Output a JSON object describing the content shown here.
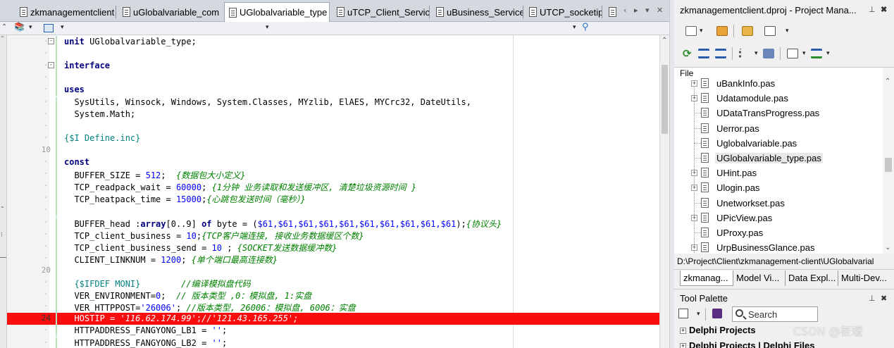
{
  "editor_tabs": [
    {
      "label": "zkmanagementclient"
    },
    {
      "label": "uGlobalvariable_com"
    },
    {
      "label": "UGlobalvariable_type"
    },
    {
      "label": "uTCP_Client_Service"
    },
    {
      "label": "uBusiness_Service"
    },
    {
      "label": "UTCP_socketip"
    }
  ],
  "active_tab": "UGlobalvariable_type",
  "code_lines": [
    {
      "num": "",
      "parts": [
        [
          "kw",
          "unit"
        ],
        [
          "plain",
          " UGlobalvariable_type;"
        ]
      ],
      "fold": "-"
    },
    {
      "num": "",
      "parts": []
    },
    {
      "num": "",
      "parts": [
        [
          "kw",
          "interface"
        ]
      ],
      "fold": "-"
    },
    {
      "num": "",
      "parts": []
    },
    {
      "num": "",
      "parts": [
        [
          "kw",
          "uses"
        ]
      ]
    },
    {
      "num": "",
      "parts": [
        [
          "plain",
          "  SysUtils, Winsock, Windows, System.Classes, MYzlib, ElAES, MYCrc32, DateUtils,"
        ]
      ]
    },
    {
      "num": "",
      "parts": [
        [
          "plain",
          "  System.Math;"
        ]
      ]
    },
    {
      "num": "",
      "parts": []
    },
    {
      "num": "",
      "parts": [
        [
          "dir",
          "{$I Define.inc}"
        ]
      ]
    },
    {
      "num": "10",
      "parts": []
    },
    {
      "num": "",
      "parts": [
        [
          "kw",
          "const"
        ]
      ]
    },
    {
      "num": "",
      "parts": [
        [
          "plain",
          "  BUFFER_SIZE = "
        ],
        [
          "num",
          "512"
        ],
        [
          "plain",
          ";  "
        ],
        [
          "cmt",
          "{数据包大小定义}"
        ]
      ]
    },
    {
      "num": "",
      "parts": [
        [
          "plain",
          "  TCP_readpack_wait = "
        ],
        [
          "num",
          "60000"
        ],
        [
          "plain",
          "; "
        ],
        [
          "cmt",
          "{1分钟 业务读取和发送缓冲区, 清楚垃圾资源时间 }"
        ]
      ]
    },
    {
      "num": "",
      "parts": [
        [
          "plain",
          "  TCP_heatpack_time = "
        ],
        [
          "num",
          "15000"
        ],
        [
          "plain",
          ";"
        ],
        [
          "cmt",
          "{心跳包发送时间（毫秒）}"
        ]
      ]
    },
    {
      "num": "",
      "parts": []
    },
    {
      "num": "",
      "parts": [
        [
          "plain",
          "  BUFFER_head :"
        ],
        [
          "kw",
          "array"
        ],
        [
          "plain",
          "[0..9] "
        ],
        [
          "kw",
          "of"
        ],
        [
          "plain",
          " byte = ("
        ],
        [
          "num",
          "$61,$61,$61,$61,$61,$61,$61,$61,$61,$61"
        ],
        [
          "plain",
          ");"
        ],
        [
          "cmt",
          "{协议头}"
        ]
      ]
    },
    {
      "num": "",
      "parts": [
        [
          "plain",
          "  TCP_client_business = "
        ],
        [
          "num",
          "10"
        ],
        [
          "plain",
          ";"
        ],
        [
          "cmt",
          "{TCP客户端连接, 接收业务数据缓区个数}"
        ]
      ]
    },
    {
      "num": "",
      "parts": [
        [
          "plain",
          "  TCP_client_business_send = "
        ],
        [
          "num",
          "10"
        ],
        [
          "plain",
          " ; "
        ],
        [
          "cmt",
          "{SOCKET发送数据缓冲数}"
        ]
      ]
    },
    {
      "num": "",
      "parts": [
        [
          "plain",
          "  CLIENT_LINKNUM = "
        ],
        [
          "num",
          "1200"
        ],
        [
          "plain",
          "; "
        ],
        [
          "cmt",
          "{单个端口最高连接数}"
        ]
      ]
    },
    {
      "num": "20",
      "parts": []
    },
    {
      "num": "",
      "parts": [
        [
          "dir",
          "  {$IFDEF MONI}"
        ],
        [
          "plain",
          "        "
        ],
        [
          "cmt",
          "//编译模拟盘代码"
        ]
      ]
    },
    {
      "num": "",
      "parts": [
        [
          "plain",
          "  VER_ENVIRONMENT="
        ],
        [
          "num",
          "0"
        ],
        [
          "plain",
          ";  "
        ],
        [
          "cmt",
          "// 版本类型 ,0：模拟盘, 1:实盘"
        ]
      ]
    },
    {
      "num": "",
      "parts": [
        [
          "plain",
          "  VER_HTTPPOST="
        ],
        [
          "str",
          "'26006'"
        ],
        [
          "plain",
          "; "
        ],
        [
          "cmt",
          "//版本类型, 26006：模拟盘, 6006：实盘"
        ]
      ]
    },
    {
      "num": "24",
      "parts": [
        [
          "plain",
          "  HOSTIP = "
        ],
        [
          "str",
          "'116.62.174.99'"
        ],
        [
          "plain",
          ";"
        ],
        [
          "cmt",
          "//'121.43.165.255';"
        ]
      ],
      "highlight": true
    },
    {
      "num": "",
      "parts": [
        [
          "plain",
          "  HTTPADDRESS_FANGYONG_LB1 = "
        ],
        [
          "str",
          "''"
        ],
        [
          "plain",
          ";"
        ]
      ]
    },
    {
      "num": "",
      "parts": [
        [
          "plain",
          "  HTTPADDRESS_FANGYONG_LB2 = "
        ],
        [
          "str",
          "''"
        ],
        [
          "plain",
          ";"
        ]
      ]
    }
  ],
  "project_manager": {
    "title": "zkmanagementclient.dproj - Project Mana...",
    "tree_header": "File",
    "files": [
      {
        "name": "uBankInfo.pas",
        "expandable": true
      },
      {
        "name": "Udatamodule.pas",
        "expandable": true
      },
      {
        "name": "UDataTransProgress.pas",
        "expandable": false
      },
      {
        "name": "Uerror.pas",
        "expandable": false
      },
      {
        "name": "Uglobalvariable.pas",
        "expandable": false
      },
      {
        "name": "UGlobalvariable_type.pas",
        "expandable": false,
        "selected": true
      },
      {
        "name": "UHint.pas",
        "expandable": true
      },
      {
        "name": "Ulogin.pas",
        "expandable": true
      },
      {
        "name": "Unetworkset.pas",
        "expandable": false
      },
      {
        "name": "UPicView.pas",
        "expandable": true
      },
      {
        "name": "UProxy.pas",
        "expandable": false
      },
      {
        "name": "UrpBusinessGlance.pas",
        "expandable": true
      }
    ],
    "path": "D:\\Project\\Client\\zkmanagement-client\\UGlobalvarial",
    "bottom_tabs": [
      "zkmanag...",
      "Model Vi...",
      "Data Expl...",
      "Multi-Dev..."
    ]
  },
  "tool_palette": {
    "title": "Tool Palette",
    "search_placeholder": "Search",
    "items": [
      "Delphi Projects",
      "Delphi Projects | Delphi Files"
    ]
  },
  "watermark": "CSDN @筱瑷",
  "colors": {
    "keyword": "#000080",
    "comment": "#008000",
    "string": "#0000ff",
    "highlight_line": "#f80e0e"
  }
}
